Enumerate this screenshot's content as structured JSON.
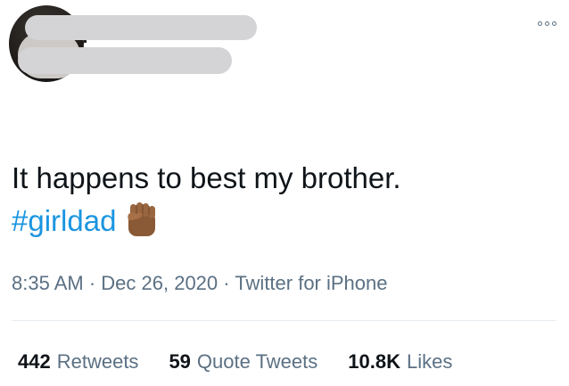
{
  "tweet": {
    "text": "It happens to best my brother.",
    "hashtag": "#girldad",
    "emoji": "fist-icon (medium-dark skin tone)",
    "time": "8:35 AM",
    "date": "Dec 26, 2020",
    "source": "Twitter for iPhone",
    "separator": " · "
  },
  "stats": [
    {
      "count": "442",
      "label": "Retweets"
    },
    {
      "count": "59",
      "label": "Quote Tweets"
    },
    {
      "count": "10.8K",
      "label": "Likes"
    }
  ],
  "colors": {
    "link": "#1b95e0",
    "secondary_text": "#5b7083",
    "primary_text": "#0f1419",
    "divider": "#e6ecf0",
    "redaction": "#d4d4d6"
  }
}
